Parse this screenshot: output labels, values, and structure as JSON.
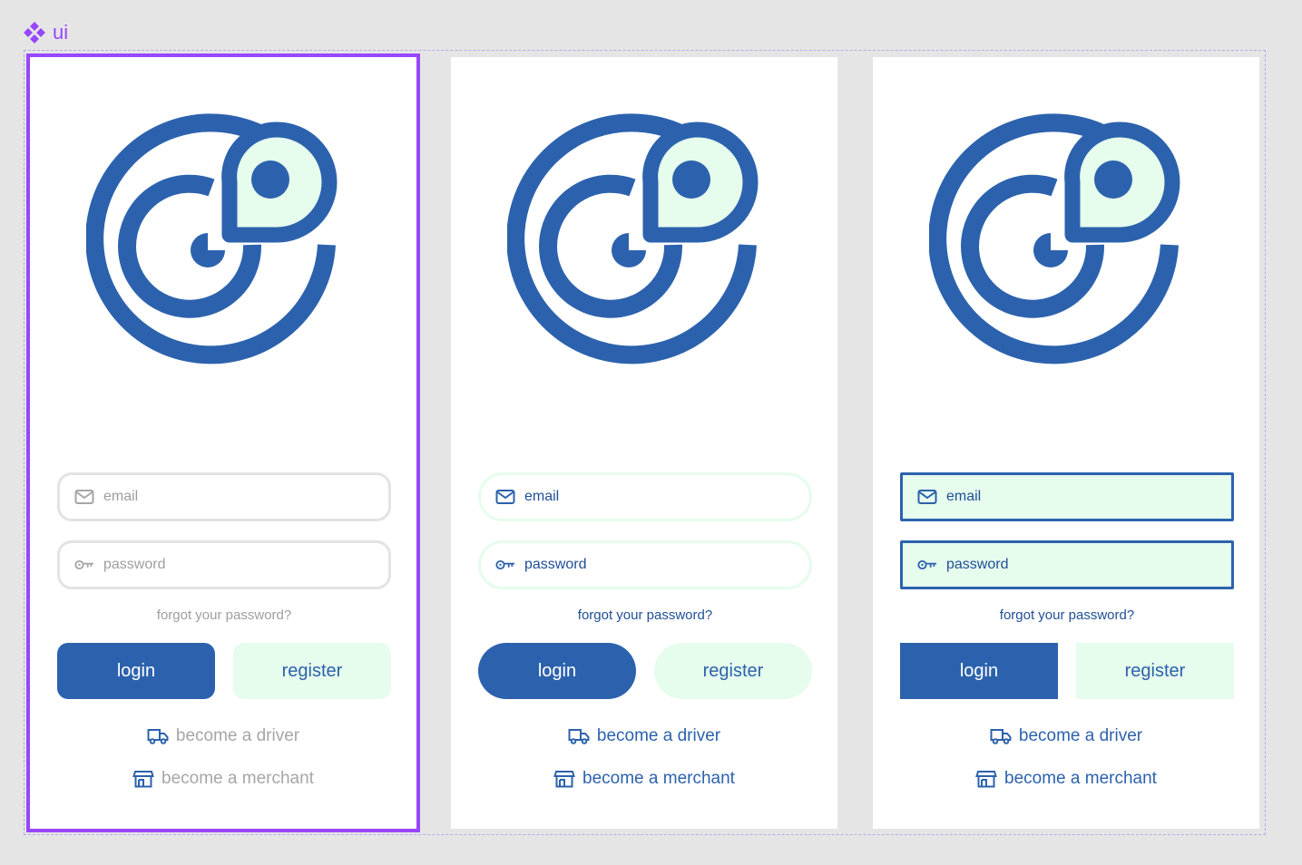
{
  "component": {
    "name": "ui",
    "icon": "component-diamond-icon",
    "color": "#9747ff"
  },
  "colors": {
    "primary": "#2c62ad",
    "mint": "#e6fcec",
    "grey_text": "#9e9e9e",
    "selection": "#9747ff"
  },
  "variants": [
    {
      "email_placeholder": "email",
      "password_placeholder": "password",
      "forgot": "forgot your password?",
      "login": "login",
      "register": "register",
      "driver": "become a driver",
      "merchant": "become a merchant"
    },
    {
      "email_placeholder": "email",
      "password_placeholder": "password",
      "forgot": "forgot your password?",
      "login": "login",
      "register": "register",
      "driver": "become a driver",
      "merchant": "become a merchant"
    },
    {
      "email_placeholder": "email",
      "password_placeholder": "password",
      "forgot": "forgot your password?",
      "login": "login",
      "register": "register",
      "driver": "become a driver",
      "merchant": "become a merchant"
    }
  ],
  "icons": [
    "logo-target-pin-icon",
    "mail-icon",
    "key-icon",
    "truck-icon",
    "store-icon"
  ]
}
